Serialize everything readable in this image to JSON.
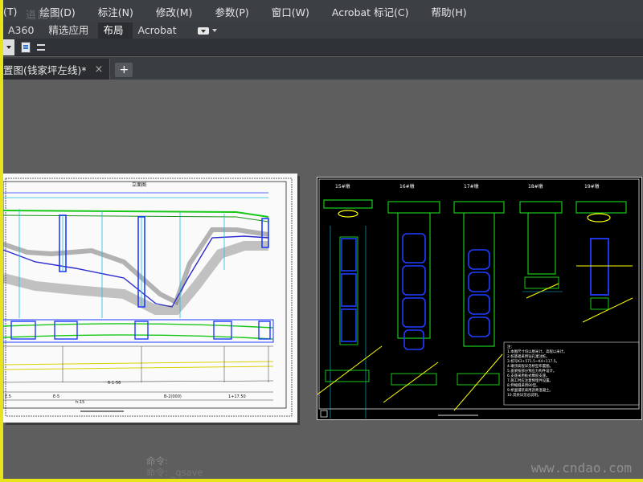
{
  "menubar": {
    "items": [
      "(T)",
      "绘图(D)",
      "标注(N)",
      "修改(M)",
      "参数(P)",
      "窗口(W)",
      "Acrobat 标记(C)",
      "帮助(H)"
    ]
  },
  "ribbon": {
    "tabs": [
      "A360",
      "精选应用",
      "布局",
      "Acrobat"
    ],
    "active_tab": "布局"
  },
  "file_tabs": [
    {
      "label": "置图(钱家坪左线)*",
      "close": "×"
    }
  ],
  "new_tab_label": "+",
  "command_line": [
    "命令:",
    "命令: _qsave"
  ],
  "watermark": {
    "top_left": "道路网",
    "bottom_right": "www.cndao.com"
  },
  "drawing_left": {
    "title": "立面图",
    "bottom_labels": [
      "E.5",
      "E-5",
      "6-1-56",
      "h-15",
      "B-2(000)",
      "1+17.50"
    ]
  },
  "drawing_right": {
    "pier_labels": [
      "15#墩",
      "16#墩",
      "17#墩",
      "18#墩",
      "19#墩"
    ],
    "notes": [
      "注：",
      "1.本图尺寸均以厘米计，高程以米计。",
      "2.桩基础采用钻孔灌注桩。",
      "3.桩号K3+571.5~K4+117.5。",
      "4.墩顶高程详见桥型布置图。",
      "5.盖梁按部分预应力构件设计。",
      "6.支座采用板式橡胶支座。",
      "7.施工时应注意预埋件设置。",
      "8.伸缩缝采用80型。",
      "9.桥面铺装采用沥青混凝土。",
      "10.其余详见总说明。"
    ]
  },
  "colors": {
    "menubar_bg": "#3c3f44",
    "canvas_bg": "#5e5e5e",
    "screen_frame": "#e8e41a"
  },
  "icons": [
    "dropdown-caret-icon",
    "document-icon",
    "lines-menu-icon",
    "close-icon",
    "plus-icon",
    "ribbon-toggle-icon"
  ]
}
